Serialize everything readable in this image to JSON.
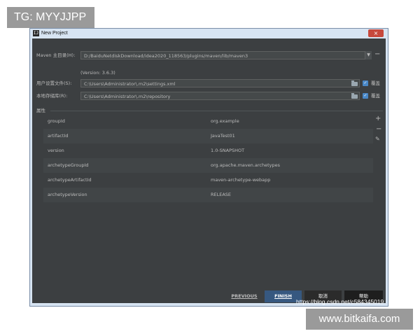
{
  "overlay": {
    "tg_badge": "TG: MYYJJPP",
    "csdn_watermark": "https://blog.csdn.net/c584345019",
    "site_badge": "www.bitkaifa.com"
  },
  "window": {
    "title": "New Project",
    "icon_glyph": "IJ",
    "close_glyph": "×"
  },
  "maven": {
    "home_label": "Maven 主目录(H):",
    "home_value": "D:/BaiduNetdiskDownload/idea2020_118563/plugins/maven/lib/maven3",
    "version_note": "(Version: 3.6.3)",
    "settings_label": "用户设置文件(S):",
    "settings_value": "C:\\Users\\Administrator\\.m2\\settings.xml",
    "repo_label": "本地存储库(R):",
    "repo_value": "C:\\Users\\Administrator\\.m2\\repository",
    "override_label": "覆盖",
    "override_settings_checked": true,
    "override_repo_checked": true
  },
  "properties": {
    "section_label": "属性",
    "rows": [
      {
        "key": "groupId",
        "value": "org.example"
      },
      {
        "key": "artifactId",
        "value": "JavaTest01"
      },
      {
        "key": "version",
        "value": "1.0-SNAPSHOT"
      },
      {
        "key": "archetypeGroupId",
        "value": "org.apache.maven.archetypes"
      },
      {
        "key": "archetypeArtifactId",
        "value": "maven-archetype-webapp"
      },
      {
        "key": "archetypeVersion",
        "value": "RELEASE"
      }
    ],
    "add_glyph": "+",
    "remove_glyph": "−",
    "edit_glyph": "✎"
  },
  "footer": {
    "previous_label": "PREVIOUS",
    "finish_label": "FINISH",
    "cancel_label": "取消",
    "help_label": "帮助"
  },
  "colors": {
    "dialog_bg": "#3c3f41",
    "field_bg": "#45494a",
    "accent_blue": "#365880",
    "checkbox_blue": "#4a88c7",
    "text": "#bbbbbb"
  },
  "icons": [
    "app-icon",
    "close-icon",
    "dropdown-arrow-icon",
    "folder-icon",
    "checkbox-checked-icon",
    "plus-icon",
    "minus-icon",
    "edit-icon"
  ]
}
